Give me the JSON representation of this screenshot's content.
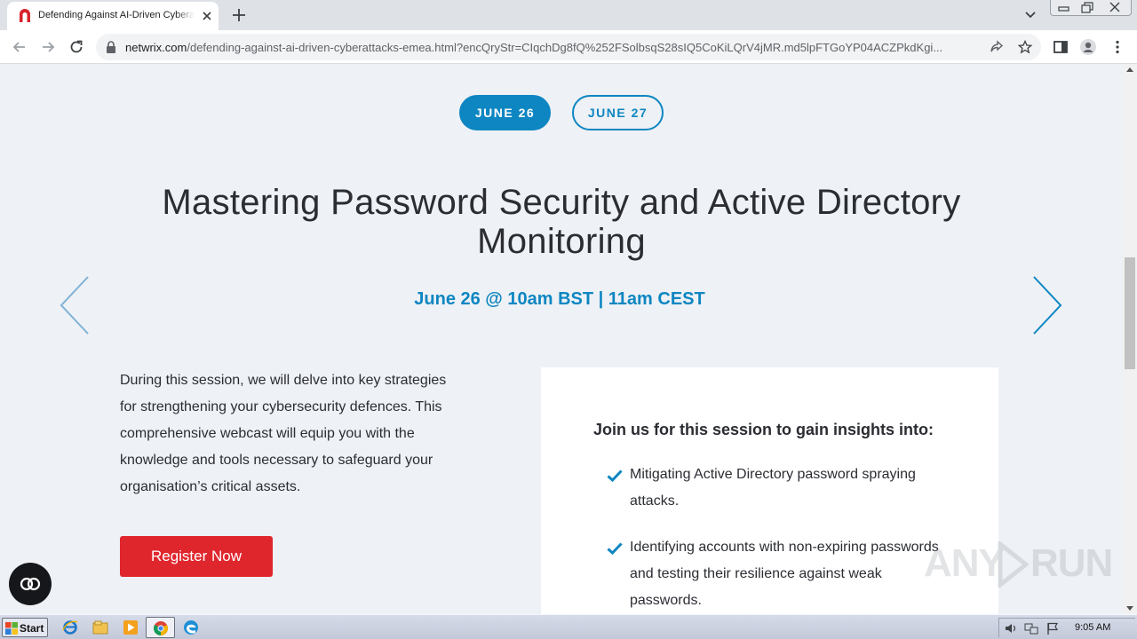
{
  "browser": {
    "tab_title": "Defending Against AI-Driven Cyberattacks",
    "url_domain": "netwrix.com",
    "url_path": "/defending-against-ai-driven-cyberattacks-emea.html?encQryStr=CIqchDg8fQ%252FSolbsqS28sIQ5CoKiLQrV4jMR.md5lpFTGoYP04ACZPkdKgi..."
  },
  "dates": {
    "active_label": "JUNE 26",
    "inactive_label": "JUNE 27"
  },
  "session": {
    "title": "Mastering Password Security and Active Directory Monitoring",
    "time": "June 26 @ 10am BST | 11am CEST",
    "description": "During this session, we will delve into key strategies for strengthening your cybersecurity defences. This comprehensive webcast will equip you with the knowledge and tools necessary to safeguard your organisation’s critical assets.",
    "register_label": "Register Now"
  },
  "insights": {
    "heading": "Join us for this session to gain insights into:",
    "items": [
      "Mitigating Active Directory password spraying attacks.",
      "Identifying accounts with non-expiring passwords and testing their resilience against weak passwords."
    ]
  },
  "watermark": {
    "text_left": "ANY",
    "text_right": "RUN"
  },
  "taskbar": {
    "start_label": "Start",
    "clock": "9:05 AM"
  },
  "colors": {
    "accent": "#0d86c2",
    "register": "#e0262d",
    "page_bg": "#eef1f5"
  }
}
